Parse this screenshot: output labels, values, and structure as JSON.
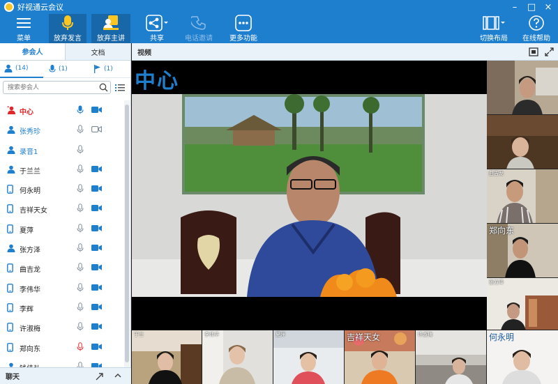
{
  "app": {
    "title": "好视通云会议"
  },
  "toolbar": {
    "menu": "菜单",
    "give_up_speaking": "放弃发言",
    "give_up_presenter": "放弃主讲",
    "share": "共享",
    "phone_invite": "电话邀请",
    "more_functions": "更多功能",
    "switch_layout": "切换布局",
    "online_help": "在线帮助"
  },
  "left_panel": {
    "tabs": [
      "参会人",
      "文档"
    ],
    "filters": {
      "all": "(14)",
      "mic": "(1)",
      "raised": "(1)"
    },
    "search_placeholder": "搜索参会人",
    "participants": [
      {
        "name": "中心",
        "type": "host",
        "mic": "on",
        "cam": "on",
        "style": "red"
      },
      {
        "name": "张秀珍",
        "type": "person",
        "mic": "off",
        "cam": "off-outline",
        "style": "blue"
      },
      {
        "name": "录音1",
        "type": "person",
        "mic": "off",
        "cam": "none",
        "style": "blue"
      },
      {
        "name": "于兰兰",
        "type": "person",
        "mic": "off",
        "cam": "on",
        "style": "normal"
      },
      {
        "name": "何永明",
        "type": "phone",
        "mic": "off",
        "cam": "on",
        "style": "normal"
      },
      {
        "name": "吉祥天女",
        "type": "phone",
        "mic": "off",
        "cam": "on",
        "style": "normal"
      },
      {
        "name": "夏萍",
        "type": "phone",
        "mic": "off",
        "cam": "on",
        "style": "normal"
      },
      {
        "name": "张方泽",
        "type": "person",
        "mic": "off",
        "cam": "on",
        "style": "normal"
      },
      {
        "name": "曲吉龙",
        "type": "phone",
        "mic": "off",
        "cam": "on",
        "style": "normal"
      },
      {
        "name": "李伟华",
        "type": "phone",
        "mic": "off",
        "cam": "on",
        "style": "normal"
      },
      {
        "name": "李辉",
        "type": "phone",
        "mic": "off",
        "cam": "on",
        "style": "normal"
      },
      {
        "name": "许淑梅",
        "type": "phone",
        "mic": "off",
        "cam": "on",
        "style": "normal"
      },
      {
        "name": "郑向东",
        "type": "phone",
        "mic": "muted-red",
        "cam": "on",
        "style": "normal"
      },
      {
        "name": "钱佳弘",
        "type": "person",
        "mic": "off",
        "cam": "on",
        "style": "normal"
      }
    ],
    "chat_label": "聊天"
  },
  "video": {
    "header": "视频",
    "main_label": "中心",
    "side_tiles": [
      {
        "name": ""
      },
      {
        "name": ""
      },
      {
        "name": "曲吉龙"
      },
      {
        "name": "郑向东"
      },
      {
        "name": "张方泽"
      }
    ],
    "bottom_tiles": [
      {
        "name": "于兰"
      },
      {
        "name": "李伟华"
      },
      {
        "name": "夏萍"
      },
      {
        "name": "吉祥天女"
      },
      {
        "name": "许淑梅"
      },
      {
        "name": "何永明"
      }
    ]
  },
  "colors": {
    "brand": "#1f7fcf",
    "toolbar_active": "#1867a8",
    "muted": "#e2262a"
  }
}
